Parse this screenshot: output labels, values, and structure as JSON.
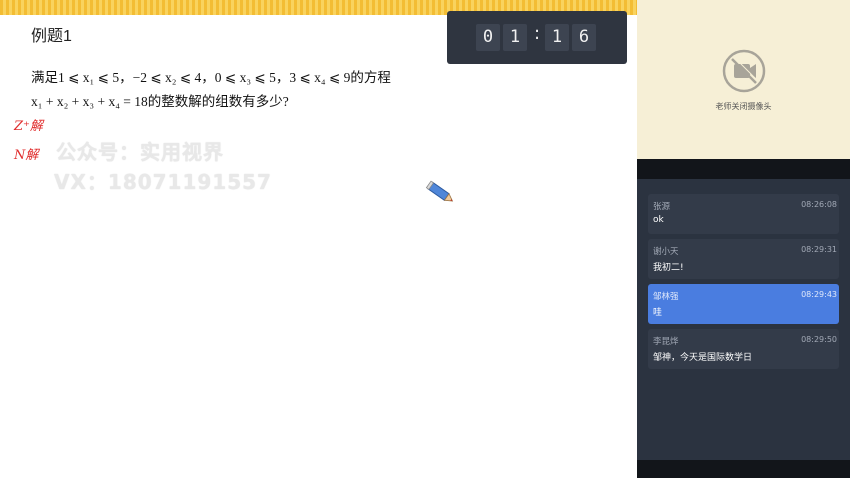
{
  "board": {
    "title": "例题1",
    "problem_line1": "满足1 ⩽ x₁ ⩽ 5，−2 ⩽ x₂ ⩽ 4，0 ⩽ x₃ ⩽ 5，3 ⩽ x₄ ⩽ 9的方程",
    "problem_line2": "x₁ + x₂ + x₃ + x₄ = 18的整数解的组数有多少?",
    "handwritten_note1": "Z⁺解",
    "handwritten_note2": "N解",
    "watermark_line1": "公众号：实用视界",
    "watermark_line2": "VX：18071191557",
    "pencil_icon": "pencil-icon"
  },
  "timer": {
    "digits": [
      "0",
      "1",
      "1",
      "6"
    ],
    "separator": ":"
  },
  "camera": {
    "status_text": "老师关闭摄像头",
    "icon": "camera-off-icon"
  },
  "chat": {
    "messages": [
      {
        "sender": "张源",
        "time": "08:26:08",
        "text": "ok",
        "highlighted": false
      },
      {
        "sender": "谢小天",
        "time": "08:29:31",
        "text": "我初二!",
        "highlighted": false
      },
      {
        "sender": "邹林强",
        "time": "08:29:43",
        "text": "哇",
        "highlighted": true
      },
      {
        "sender": "李昆烨",
        "time": "08:29:50",
        "text": "邹神，今天是国际数学日",
        "highlighted": false
      }
    ]
  },
  "colors": {
    "accent_yellow": "#f7c948",
    "chat_bg": "#2b3340",
    "message_bg": "#333b49",
    "highlight": "#4a7de0",
    "annotation_red": "#e02d2d",
    "camera_panel_bg": "#f6efd6"
  }
}
